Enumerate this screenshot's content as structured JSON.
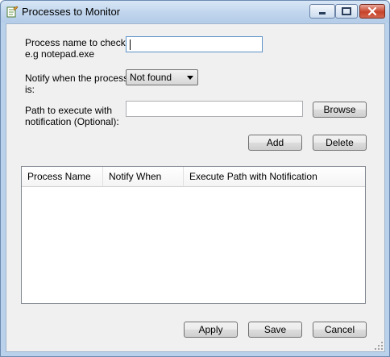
{
  "window": {
    "title": "Processes to Monitor",
    "icon": "notepad-app-icon"
  },
  "form": {
    "process_label_1": "Process name to check:",
    "process_label_2": "e.g notepad.exe",
    "process_value": "",
    "notify_label_1": "Notify when the process",
    "notify_label_2": "is:",
    "notify_selected": "Not found",
    "path_label_1": "Path to execute with",
    "path_label_2": "notification (Optional):",
    "path_value": "",
    "browse_label": "Browse",
    "add_label": "Add",
    "delete_label": "Delete"
  },
  "list": {
    "columns": [
      "Process Name",
      "Notify When",
      "Execute Path with Notification"
    ],
    "rows": []
  },
  "footer": {
    "apply_label": "Apply",
    "save_label": "Save",
    "cancel_label": "Cancel"
  }
}
